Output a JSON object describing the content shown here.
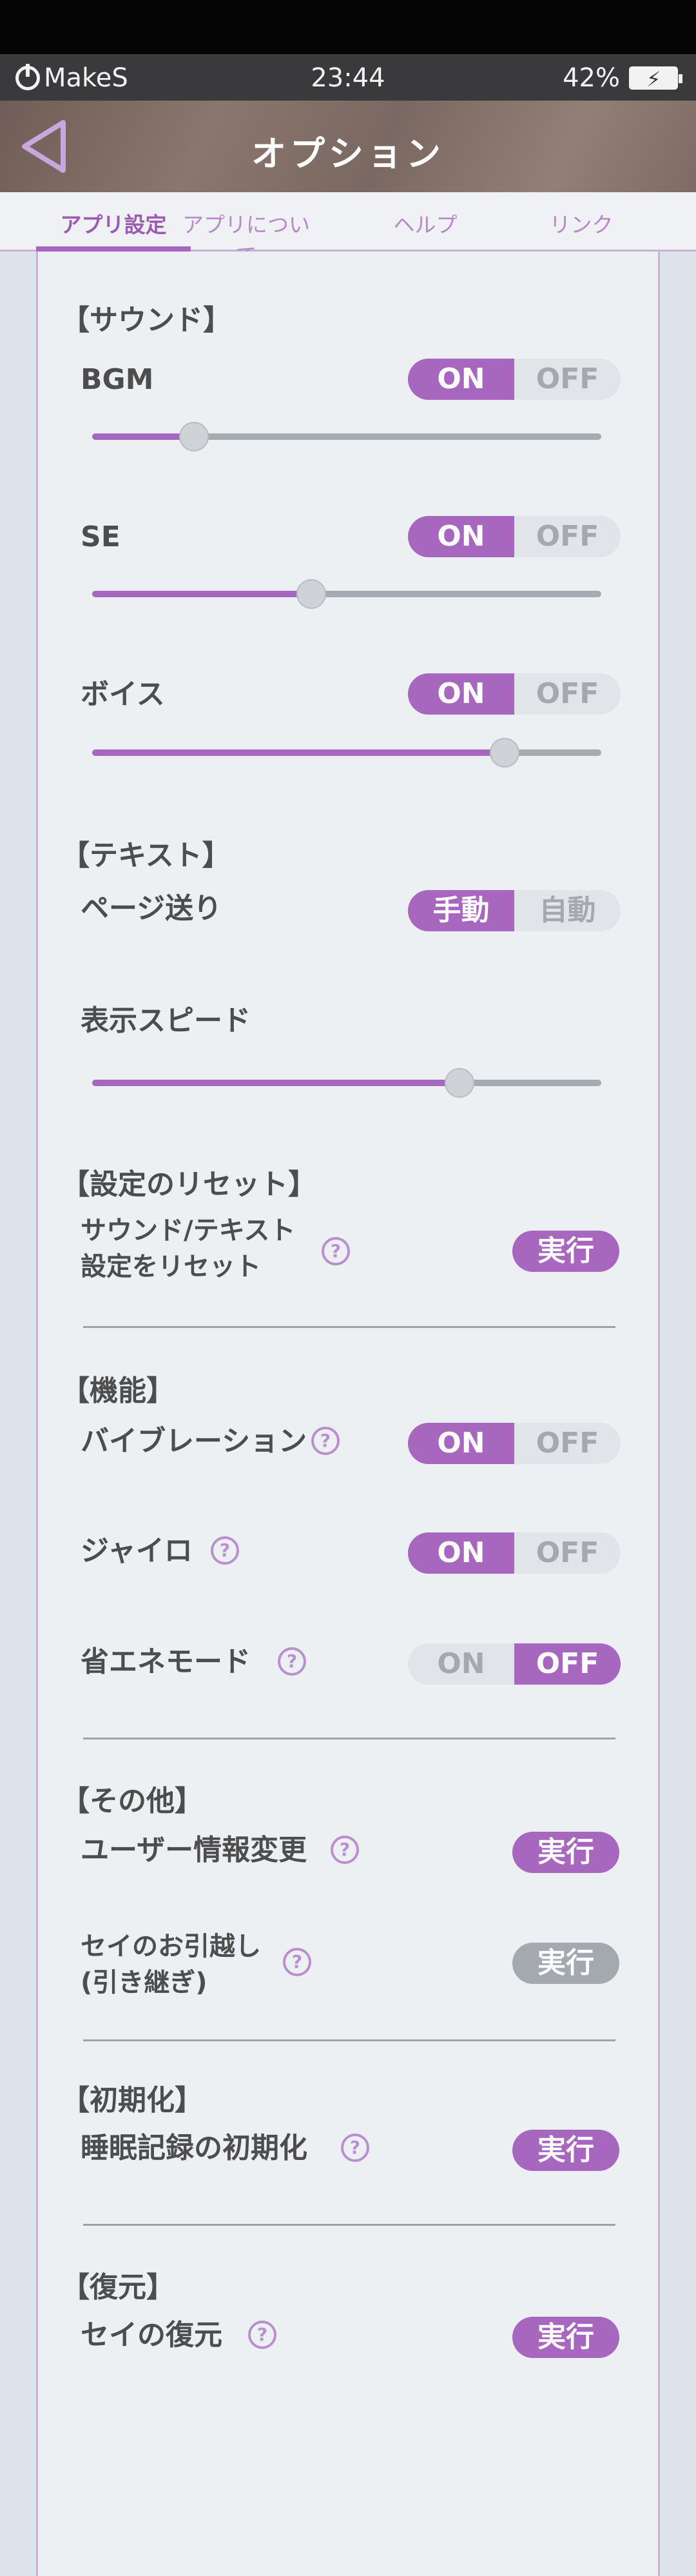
{
  "status_bar": {
    "carrier": "MakeS",
    "time": "23:44",
    "battery": "42%"
  },
  "header": {
    "title": "オプション"
  },
  "tabs": [
    {
      "label": "アプリ設定",
      "active": true
    },
    {
      "label": "アプリについて",
      "active": false
    },
    {
      "label": "ヘルプ",
      "active": false
    },
    {
      "label": "リンク",
      "active": false
    }
  ],
  "sound": {
    "heading": "【サウンド】",
    "bgm": {
      "label": "BGM",
      "on": "ON",
      "off": "OFF",
      "state": "on",
      "level": 0.2
    },
    "se": {
      "label": "SE",
      "on": "ON",
      "off": "OFF",
      "state": "on",
      "level": 0.43
    },
    "voice": {
      "label": "ボイス",
      "on": "ON",
      "off": "OFF",
      "state": "on",
      "level": 0.81
    }
  },
  "text": {
    "heading": "【テキスト】",
    "page_feed": {
      "label": "ページ送り",
      "manual": "手動",
      "auto": "自動",
      "state": "manual"
    },
    "speed": {
      "label": "表示スピード",
      "level": 0.72
    }
  },
  "reset": {
    "heading": "【設定のリセット】",
    "label_line1": "サウンド/テキスト",
    "label_line2": "設定をリセット",
    "button": "実行"
  },
  "features": {
    "heading": "【機能】",
    "vibration": {
      "label": "バイブレーション",
      "on": "ON",
      "off": "OFF",
      "state": "on"
    },
    "gyro": {
      "label": "ジャイロ",
      "on": "ON",
      "off": "OFF",
      "state": "on"
    },
    "eco": {
      "label": "省エネモード",
      "on": "ON",
      "off": "OFF",
      "state": "off"
    }
  },
  "other": {
    "heading": "【その他】",
    "user_info": {
      "label": "ユーザー情報変更",
      "button": "実行"
    },
    "transfer": {
      "label_line1": "セイのお引越し",
      "label_line2": "(引き継ぎ)",
      "button": "実行",
      "enabled": false
    }
  },
  "init": {
    "heading": "【初期化】",
    "sleep_init": {
      "label": "睡眠記録の初期化",
      "button": "実行"
    }
  },
  "restore": {
    "heading": "【復元】",
    "sei_restore": {
      "label": "セイの復元",
      "button": "実行"
    }
  },
  "help_glyph": "?",
  "colors": {
    "accent": "#a767bf",
    "disabled": "#a3a9ae",
    "header": "#7d6b65"
  }
}
